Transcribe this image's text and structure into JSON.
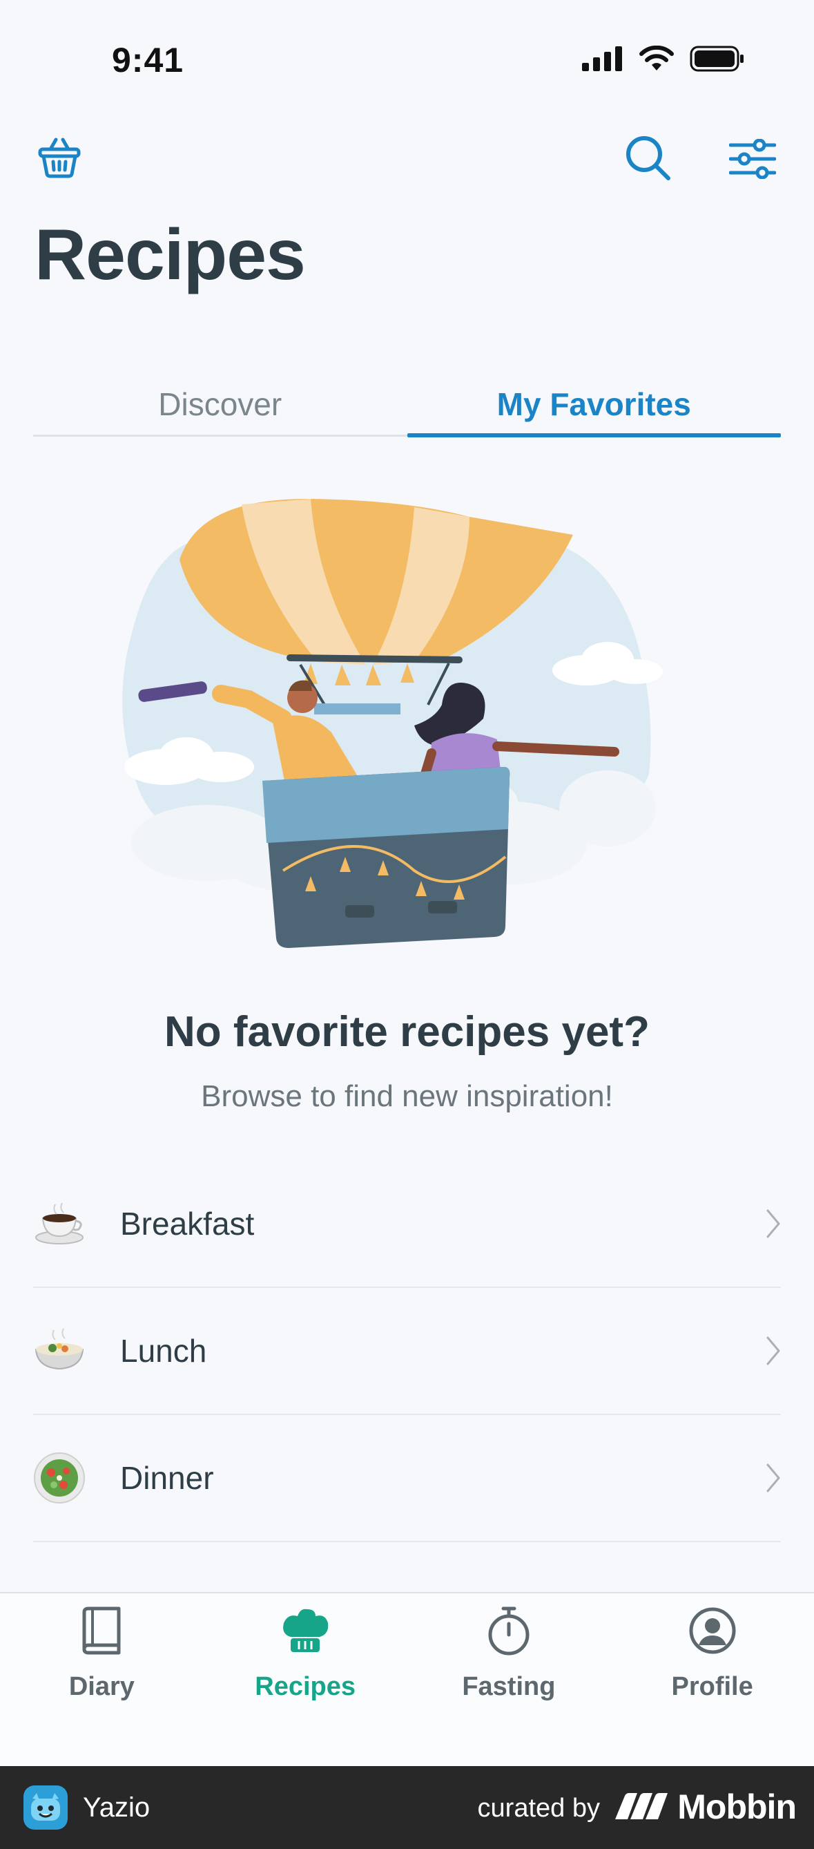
{
  "status_bar": {
    "time": "9:41"
  },
  "header": {
    "title": "Recipes",
    "basket_icon": "basket-icon",
    "search_icon": "search-icon",
    "filter_icon": "filter-sliders-icon",
    "accent_color": "#1a84c6"
  },
  "tabs": [
    {
      "label": "Discover",
      "active": false
    },
    {
      "label": "My Favorites",
      "active": true
    }
  ],
  "empty_state": {
    "title": "No favorite recipes yet?",
    "subtitle": "Browse to find new inspiration!"
  },
  "categories": [
    {
      "label": "Breakfast",
      "icon": "coffee-cup-icon"
    },
    {
      "label": "Lunch",
      "icon": "soup-bowl-icon"
    },
    {
      "label": "Dinner",
      "icon": "salad-plate-icon"
    }
  ],
  "bottom_nav": [
    {
      "label": "Diary",
      "icon": "book-icon",
      "active": false
    },
    {
      "label": "Recipes",
      "icon": "chef-hat-icon",
      "active": true
    },
    {
      "label": "Fasting",
      "icon": "stopwatch-icon",
      "active": false
    },
    {
      "label": "Profile",
      "icon": "user-circle-icon",
      "active": false
    }
  ],
  "footer": {
    "app_name": "Yazio",
    "curated_by": "curated by",
    "brand": "Mobbin"
  },
  "colors": {
    "active_nav": "#17a589",
    "active_tab": "#1a84c6",
    "background": "#f6f8fb"
  }
}
